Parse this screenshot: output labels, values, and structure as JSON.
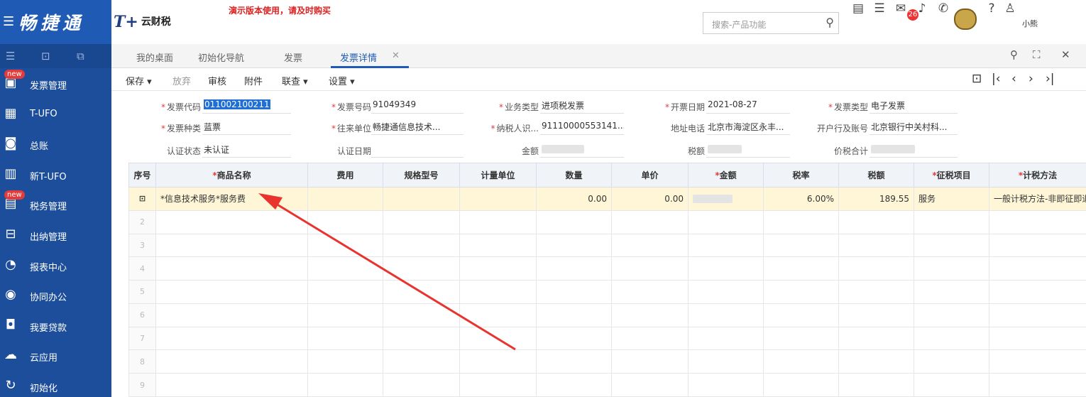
{
  "header": {
    "brand": "畅捷通",
    "logo_text": "云财税",
    "demo_notice": "演示版本使用，请及时购买",
    "search_placeholder": "搜索-产品功能",
    "notification_count": "26",
    "user_name": "小熊"
  },
  "sidebar": {
    "items": [
      {
        "label": "发票管理",
        "icon": "invoice-icon",
        "new": true
      },
      {
        "label": "T-UFO",
        "icon": "ufo-icon",
        "new": false
      },
      {
        "label": "总账",
        "icon": "ledger-icon",
        "new": false
      },
      {
        "label": "新T-UFO",
        "icon": "report-grid-icon",
        "new": false
      },
      {
        "label": "税务管理",
        "icon": "tax-icon",
        "new": true
      },
      {
        "label": "出纳管理",
        "icon": "cashier-icon",
        "new": false
      },
      {
        "label": "报表中心",
        "icon": "report-icon",
        "new": false
      },
      {
        "label": "协同办公",
        "icon": "collab-icon",
        "new": false
      },
      {
        "label": "我要贷款",
        "icon": "loan-icon",
        "new": false
      },
      {
        "label": "云应用",
        "icon": "cloud-icon",
        "new": false
      },
      {
        "label": "初始化",
        "icon": "init-icon",
        "new": false
      }
    ],
    "new_tag": "new"
  },
  "tabs": [
    "我的桌面",
    "初始化导航",
    "发票",
    "发票详情"
  ],
  "toolbar": {
    "save": "保存",
    "discard": "放弃",
    "audit": "审核",
    "attachment": "附件",
    "linked_query": "联查",
    "settings": "设置"
  },
  "form": {
    "invoice_code_label": "发票代码",
    "invoice_code": "011002100211",
    "invoice_no_label": "发票号码",
    "invoice_no": "91049349",
    "biz_type_label": "业务类型",
    "biz_type": "进项税发票",
    "issue_date_label": "开票日期",
    "issue_date": "2021-08-27",
    "invoice_type_label": "发票类型",
    "invoice_type": "电子发票",
    "invoice_kind_label": "发票种类",
    "invoice_kind": "蓝票",
    "partner_label": "往来单位",
    "partner": "畅捷通信息技术...",
    "taxpayer_id_label": "纳税人识...",
    "taxpayer_id": "91110000553141...",
    "address_label": "地址电话",
    "address": "北京市海淀区永丰...",
    "bank_label": "开户行及账号",
    "bank": "北京银行中关村科...",
    "cert_status_label": "认证状态",
    "cert_status": "未认证",
    "cert_date_label": "认证日期",
    "amount_label": "金额",
    "tax_label": "税额",
    "total_label": "价税合计"
  },
  "grid": {
    "columns": [
      "序号",
      "商品名称",
      "费用",
      "规格型号",
      "计量单位",
      "数量",
      "单价",
      "金额",
      "税率",
      "税额",
      "征税项目",
      "计税方法"
    ],
    "required_columns": [
      1,
      7,
      10,
      11
    ],
    "row1": {
      "goods_name": "*信息技术服务*服务费",
      "quantity": "0.00",
      "unit_price": "0.00",
      "tax_rate": "6.00%",
      "tax_amount": "189.55",
      "tax_item": "服务",
      "tax_method": "一般计税方法-非即征即退"
    },
    "empty_rows": [
      "2",
      "3",
      "4",
      "5",
      "6",
      "7",
      "8",
      "9"
    ]
  }
}
